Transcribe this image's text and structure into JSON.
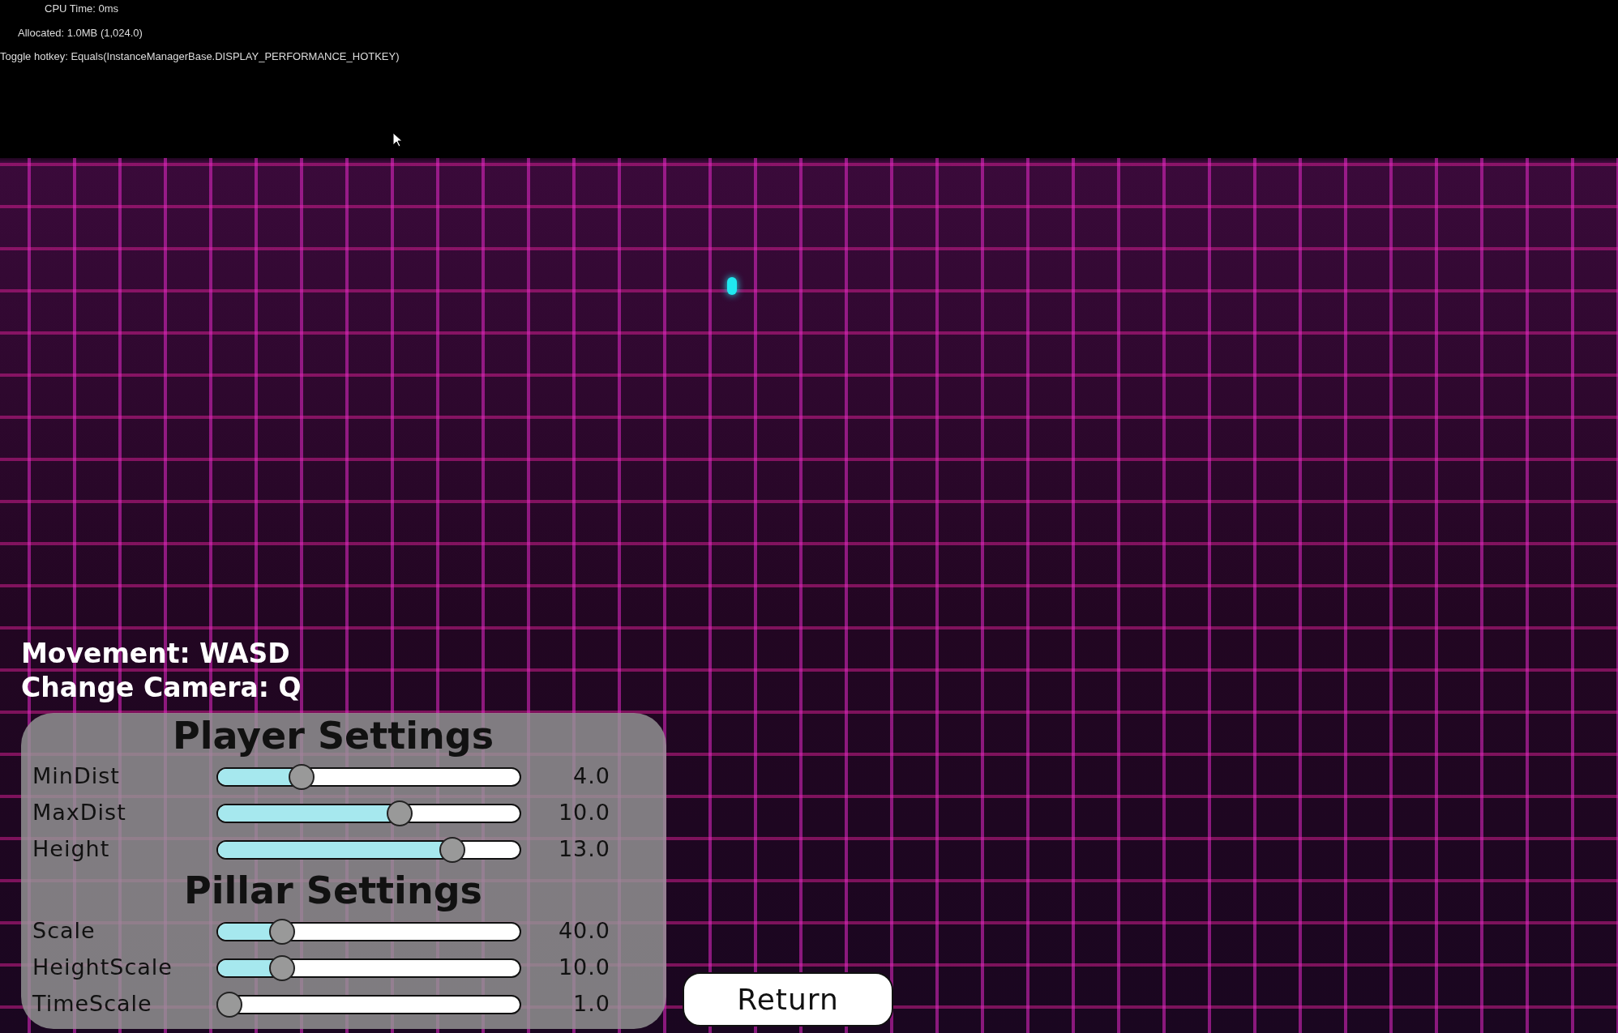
{
  "performance_overlay": [
    "CPU Time: 0ms",
    "Allocated: 1.0MB (1,024.0)",
    "Toggle hotkey: Equals(InstanceManagerBase.DISPLAY_PERFORMANCE_HOTKEY)"
  ],
  "controls_hint": [
    "Movement: WASD",
    "Change Camera: Q"
  ],
  "settings_panel": [
    {
      "title": "Player Settings",
      "sliders": [
        {
          "label": "MinDist",
          "level": 0.26,
          "reading": "4.0"
        },
        {
          "label": "MaxDist",
          "level": 0.61,
          "reading": "10.0"
        },
        {
          "label": "Height",
          "level": 0.8,
          "reading": "13.0"
        }
      ]
    },
    {
      "title": "Pillar Settings",
      "sliders": [
        {
          "label": "Scale",
          "level": 0.19,
          "reading": "40.0"
        },
        {
          "label": "HeightScale",
          "level": 0.19,
          "reading": "10.0"
        },
        {
          "label": "TimeScale",
          "level": 0,
          "reading": "1.0"
        }
      ]
    }
  ],
  "return_button": "Return"
}
